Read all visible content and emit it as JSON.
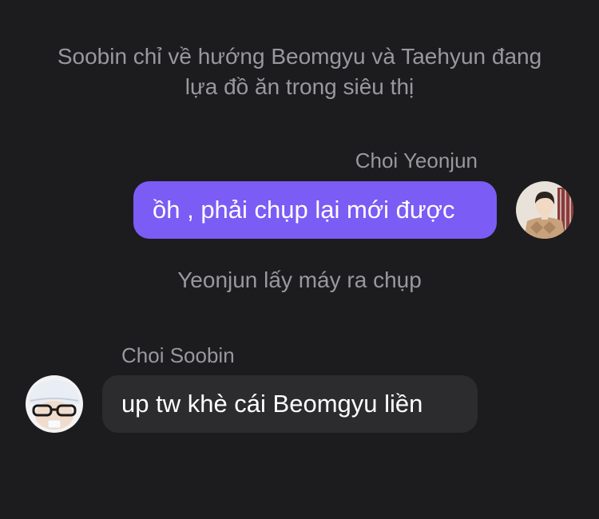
{
  "chat": {
    "narration_1": "Soobin chỉ về hướng Beomgyu và Taehyun đang lựa đồ ăn trong siêu thị",
    "narration_2": "Yeonjun lấy máy ra chụp",
    "messages": [
      {
        "sender": "Choi Yeonjun",
        "text": "ồh , phải chụp lại mới được",
        "side": "right",
        "bubble_color": "#7b5cf5",
        "avatar_icon": "avatar-photo-icon"
      },
      {
        "sender": "Choi Soobin",
        "text": "up tw khè cái Beomgyu liền",
        "side": "left",
        "bubble_color": "#2c2c2e",
        "avatar_icon": "avatar-photo-icon"
      }
    ]
  },
  "colors": {
    "background": "#1c1c1e",
    "narration_text": "#98989e",
    "outgoing_bubble": "#7b5cf5",
    "incoming_bubble": "#2c2c2e"
  }
}
